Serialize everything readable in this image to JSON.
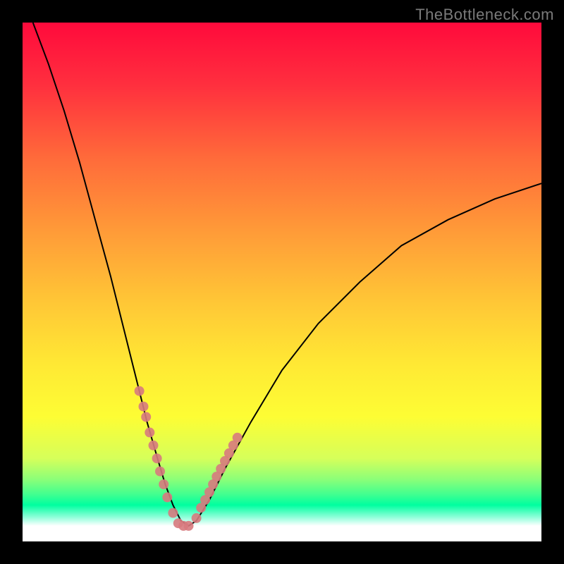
{
  "watermark": "TheBottleneck.com",
  "colors": {
    "bg": "#000000",
    "curve": "#000000",
    "dots": "#d77a7e",
    "gradient_top": "#ff0a3c",
    "gradient_mid": "#ffe934",
    "gradient_green": "#00ffa0",
    "gradient_bottom": "#ffffff"
  },
  "chart_data": {
    "type": "line",
    "title": "",
    "xlabel": "",
    "ylabel": "",
    "xlim": [
      0,
      100
    ],
    "ylim": [
      0,
      100
    ],
    "legend": false,
    "grid": false,
    "series": [
      {
        "name": "bottleneck-curve",
        "x": [
          2,
          5,
          8,
          11,
          14,
          17,
          20,
          22,
          24,
          26,
          27.5,
          29,
          30.5,
          32,
          33.5,
          36,
          39,
          44,
          50,
          57,
          65,
          73,
          82,
          91,
          100
        ],
        "y": [
          100,
          92,
          83,
          73,
          62,
          51,
          39,
          31,
          23,
          16,
          11,
          7,
          4,
          3,
          4,
          8,
          14,
          23,
          33,
          42,
          50,
          57,
          62,
          66,
          69
        ]
      }
    ],
    "annotations": {
      "dots": {
        "name": "highlight-points",
        "x": [
          22.5,
          23.3,
          23.8,
          24.5,
          25.2,
          25.9,
          26.5,
          27.2,
          27.9,
          29.0,
          30.0,
          31.0,
          32.0,
          33.5,
          34.4,
          35.2,
          36.0,
          36.7,
          37.4,
          38.2,
          39.0,
          39.8,
          40.6,
          41.4
        ],
        "y": [
          29,
          26,
          24,
          21,
          18.5,
          16,
          13.5,
          11,
          8.5,
          5.5,
          3.5,
          3,
          3,
          4.5,
          6.5,
          8,
          9.5,
          11,
          12.5,
          14,
          15.5,
          17,
          18.5,
          20
        ]
      }
    }
  }
}
